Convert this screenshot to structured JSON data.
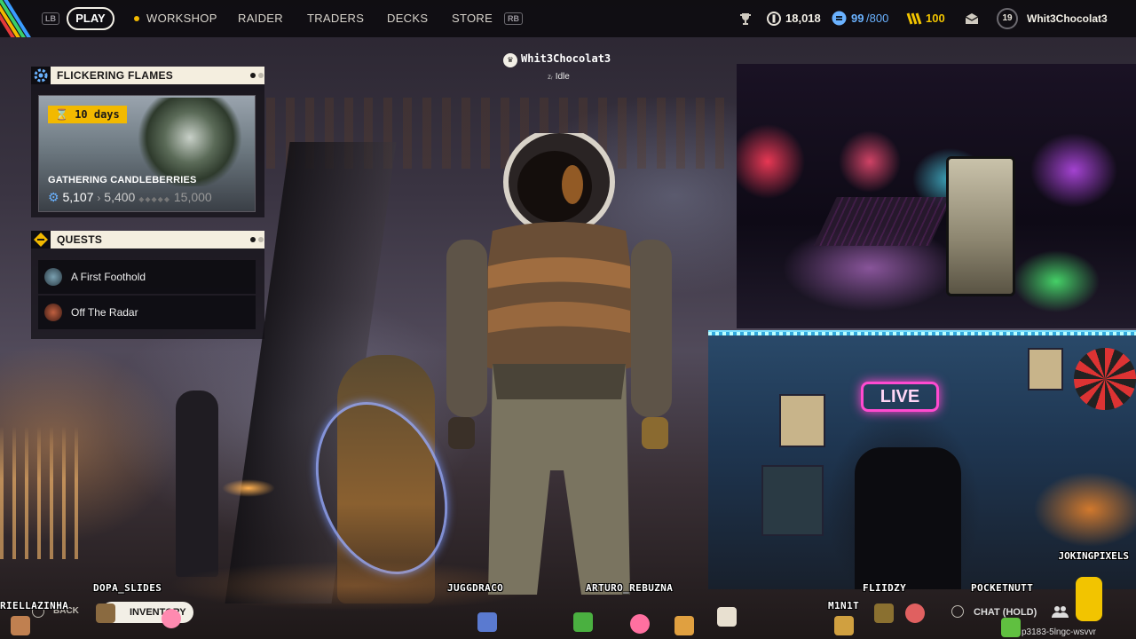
{
  "topbar": {
    "lb": "LB",
    "rb": "RB",
    "nav": {
      "play": "PLAY",
      "workshop": "WORKSHOP",
      "raider": "RAIDER",
      "traders": "TRADERS",
      "decks": "DECKS",
      "store": "STORE"
    },
    "stats": {
      "coins": "18,018",
      "stash_used": "99",
      "stash_total": "/800",
      "tokens": "100"
    },
    "player": {
      "level": "19",
      "name": "Whit3Chocolat3"
    },
    "icons": [
      "trophy-icon",
      "coin-icon",
      "stash-icon",
      "tokens-icon",
      "mail-icon"
    ]
  },
  "event_panel": {
    "title": "FLICKERING FLAMES",
    "timer": "10 days",
    "objective": "GATHERING CANDLEBERRIES",
    "current": "5,107",
    "next_tier": "5,400",
    "max_tier": "15,000",
    "page_index": 1,
    "page_count": 2
  },
  "quests_panel": {
    "title": "QUESTS",
    "items": [
      {
        "label": "A First Foothold"
      },
      {
        "label": "Off The Radar"
      }
    ],
    "page_index": 1,
    "page_count": 2
  },
  "player_tag": {
    "name": "Whit3Chocolat3",
    "status": "Idle"
  },
  "bottom_controls": {
    "back": "BACK",
    "pill_label": "INVENTORY",
    "chat": "CHAT (HOLD)",
    "room_code": "p3183-5lngc-wsvvr"
  },
  "webcam": {
    "sign": "LIVE",
    "label": "JOKINGPIXELS"
  },
  "viewers": {
    "v1": "DOPA_SLIDES",
    "v2": "RIELLAZINHA",
    "v3": "JUGGDRACO",
    "v4": "ARTURO_REBUZNA",
    "v5": "FLIIDZY",
    "v6": "POCKETNUTT",
    "v7": "M1N1T"
  },
  "colors": {
    "accent_yellow": "#f2b900",
    "panel_header": "#f4eedf",
    "stat_blue": "#6ab2ff",
    "token_gold": "#f2c400"
  }
}
